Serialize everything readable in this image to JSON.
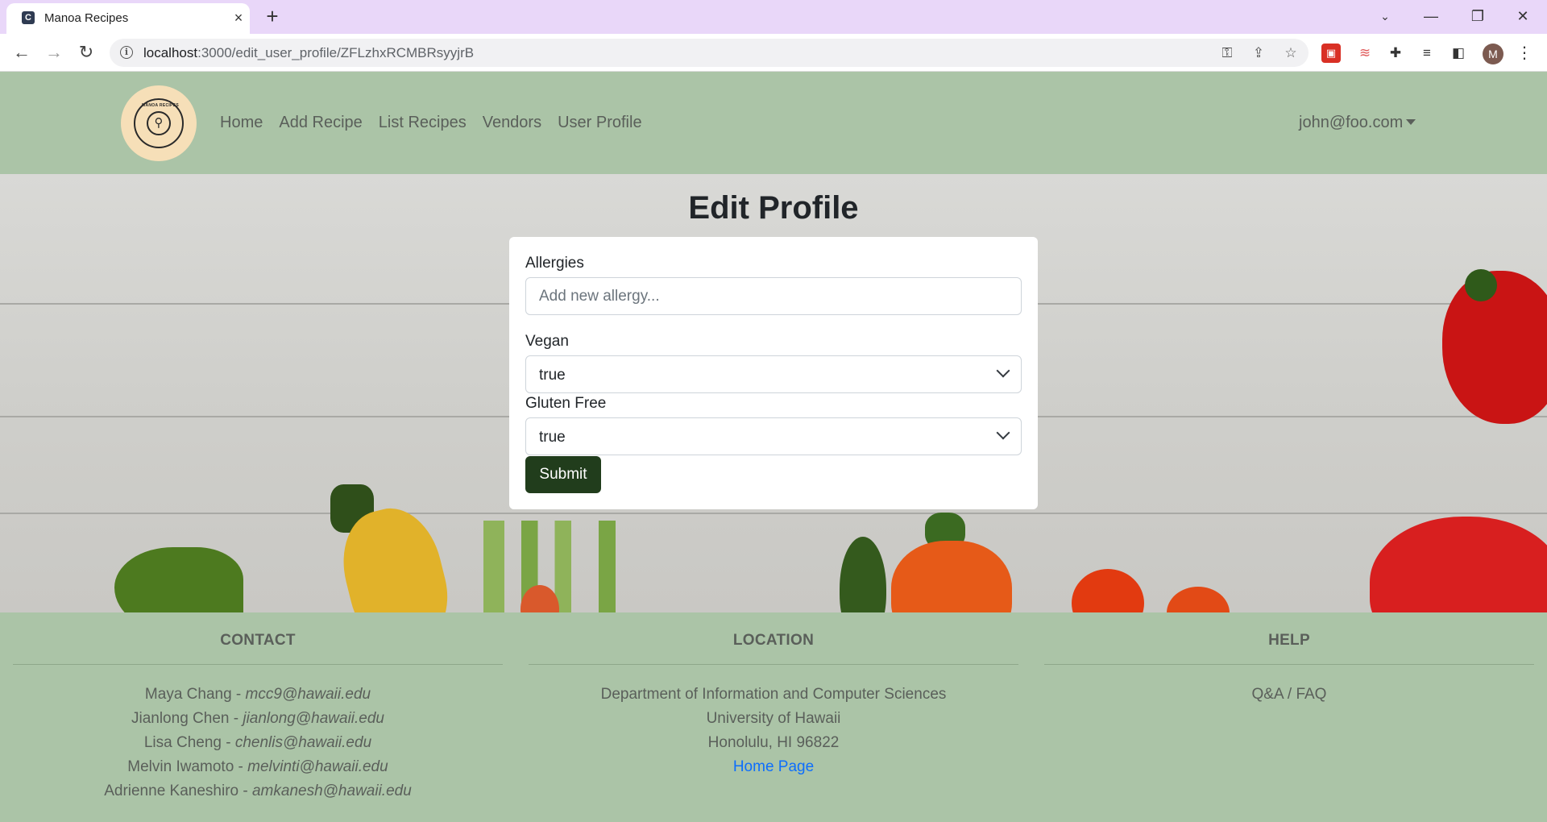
{
  "browser": {
    "tab_title": "Manoa Recipes",
    "favicon_letter": "C",
    "url_host": "localhost",
    "url_rest": ":3000/edit_user_profile/ZFLzhxRCMBRsyyjrB",
    "avatar_letter": "M"
  },
  "nav": {
    "logo_text": "MANOA RECIPES",
    "links": [
      {
        "label": "Home"
      },
      {
        "label": "Add Recipe"
      },
      {
        "label": "List Recipes"
      },
      {
        "label": "Vendors"
      },
      {
        "label": "User Profile"
      }
    ],
    "user": "john@foo.com"
  },
  "form": {
    "title": "Edit Profile",
    "allergies_label": "Allergies",
    "allergies_placeholder": "Add new allergy...",
    "vegan_label": "Vegan",
    "vegan_value": "true",
    "gluten_label": "Gluten Free",
    "gluten_value": "true",
    "submit_label": "Submit"
  },
  "footer": {
    "contact": {
      "heading": "CONTACT",
      "people": [
        {
          "name": "Maya Chang - ",
          "email": "mcc9@hawaii.edu"
        },
        {
          "name": "Jianlong Chen - ",
          "email": "jianlong@hawaii.edu"
        },
        {
          "name": "Lisa Cheng - ",
          "email": "chenlis@hawaii.edu"
        },
        {
          "name": "Melvin Iwamoto - ",
          "email": "melvinti@hawaii.edu"
        },
        {
          "name": "Adrienne Kaneshiro - ",
          "email": "amkanesh@hawaii.edu"
        }
      ]
    },
    "location": {
      "heading": "LOCATION",
      "lines": [
        "Department of Information and Computer Sciences",
        "University of Hawaii",
        "Honolulu, HI 96822"
      ],
      "link": "Home Page"
    },
    "help": {
      "heading": "HELP",
      "link": "Q&A / FAQ"
    }
  },
  "colors": {
    "nav_bg": "#abc4a7",
    "button_bg": "#213d1c",
    "tab_strip": "#e9d7f9"
  }
}
